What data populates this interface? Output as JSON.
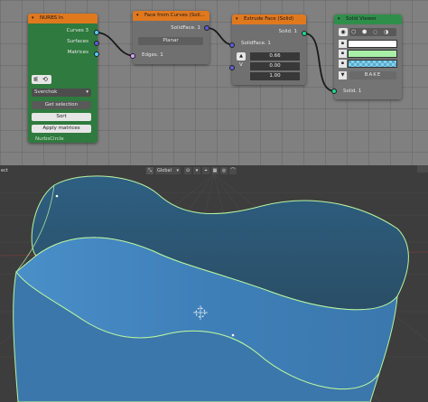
{
  "nodes": {
    "nurbs_in": {
      "title": "NURBS In",
      "outputs": [
        "Curves 3",
        "Surfaces",
        "Matrices"
      ],
      "mode_dropdown": "Sverchok",
      "buttons": [
        "Get selection",
        "Sort",
        "Apply matrices"
      ],
      "object_name": "NurbsCircle"
    },
    "face_from_curves": {
      "title": "Face from Curves (Soli...",
      "output": "SolidFace. 1",
      "mode_button": "Planar",
      "input": "Edges. 1"
    },
    "extrude_face": {
      "title": "Extrude Face (Solid)",
      "output": "Solid. 1",
      "input": "SolidFace. 1",
      "vector_values": [
        "0.66",
        "0.00",
        "1.00"
      ],
      "vector_label": "V"
    },
    "solid_viewer": {
      "title": "Solid Viewer",
      "bake_label": "BAKE",
      "input": "Solid. 1",
      "colors": {
        "vertex": "#ffffff",
        "edge": "#a8f0a8",
        "face": "#7fd2f0"
      }
    }
  },
  "viewport": {
    "left_label": "ect",
    "orientation": "Global"
  },
  "colors": {
    "node_header": "#e0781e",
    "nurbs_body": "#2f7a3e",
    "node_body": "#707070",
    "surface": "#3a7fb5"
  }
}
